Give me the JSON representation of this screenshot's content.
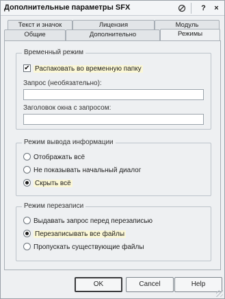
{
  "window": {
    "title": "Дополнительные параметры SFX",
    "help_button": "?",
    "close_button": "×"
  },
  "tabs": {
    "row_back": [
      {
        "label": "Текст и значок"
      },
      {
        "label": "Лицензия"
      },
      {
        "label": "Модуль"
      }
    ],
    "row_front": [
      {
        "label": "Общие"
      },
      {
        "label": "Дополнительно"
      },
      {
        "label": "Режимы",
        "active": true
      }
    ]
  },
  "temp_mode": {
    "title": "Временный режим",
    "unpack_checkbox": {
      "label": "Распаковать во временную папку",
      "checked": true
    },
    "prompt_label": "Запрос (необязательно):",
    "prompt_value": "",
    "prompt_title_label": "Заголовок окна с запросом:",
    "prompt_title_value": ""
  },
  "output_mode": {
    "title": "Режим вывода информации",
    "options": [
      {
        "label": "Отображать всё",
        "selected": false
      },
      {
        "label": "Не показывать начальный диалог",
        "selected": false
      },
      {
        "label": "Скрыть всё",
        "selected": true
      }
    ]
  },
  "overwrite_mode": {
    "title": "Режим перезаписи",
    "options": [
      {
        "label": "Выдавать запрос перед перезаписью",
        "selected": false
      },
      {
        "label": "Перезаписывать все файлы",
        "selected": true
      },
      {
        "label": "Пропускать существующие файлы",
        "selected": false
      }
    ]
  },
  "buttons": {
    "ok": "OK",
    "cancel": "Cancel",
    "help": "Help"
  }
}
